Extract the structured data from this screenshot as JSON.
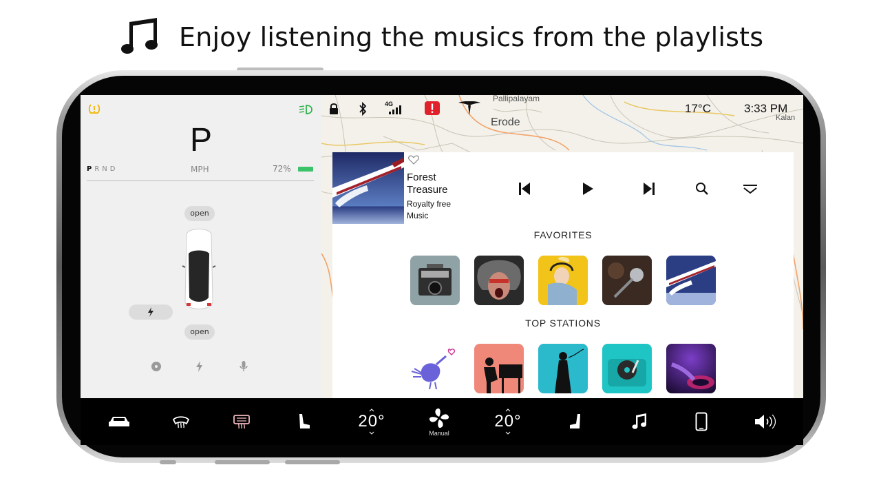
{
  "headline": {
    "icon": "music-note-icon",
    "text": "Enjoy listening the musics from the playlists"
  },
  "car_panel": {
    "gear": "P",
    "gears": [
      "P",
      "R",
      "N",
      "D"
    ],
    "active_gear": "P",
    "speed_unit": "MPH",
    "battery_percent": "72%",
    "battery_fraction": 0.72,
    "frunk_label": "open",
    "trunk_label": "open",
    "charge_icon": "bolt-icon",
    "bottom_icons": [
      "disc-icon",
      "bolt-icon",
      "microphone-icon"
    ],
    "status_icons": [
      "tire-warning-icon",
      "headlight-icon"
    ]
  },
  "status_bar": {
    "icons": [
      "lock-icon",
      "bluetooth-icon",
      "4g-signal-icon",
      "alert-icon",
      "tesla-logo-icon"
    ],
    "network": "4G",
    "temperature": "17°C",
    "time": "3:33 PM"
  },
  "map": {
    "labels": [
      "Pallipalayam",
      "Erode",
      "Kalan"
    ]
  },
  "now_playing": {
    "title": "Forest Treasure",
    "artist": "Royalty free Music",
    "controls": [
      "skip-back-icon",
      "play-icon",
      "skip-forward-icon",
      "search-icon",
      "collapse-icon"
    ]
  },
  "favorites": {
    "heading": "FAVORITES",
    "items": [
      {
        "icon": "boombox-art"
      },
      {
        "icon": "rocker-art"
      },
      {
        "icon": "headphone-girl-art"
      },
      {
        "icon": "microphone-art"
      },
      {
        "icon": "guitar-studio-art"
      }
    ]
  },
  "top_stations": {
    "heading": "TOP STATIONS",
    "items": [
      {
        "icon": "singing-bird-art"
      },
      {
        "icon": "pianist-art"
      },
      {
        "icon": "singer-art"
      },
      {
        "icon": "turntable-art"
      },
      {
        "icon": "dj-art"
      }
    ]
  },
  "bottom_bar": {
    "items": [
      "car-icon",
      "front-defrost-icon",
      "rear-defrost-icon",
      "seat-left-icon",
      "fan-icon",
      "seat-right-icon",
      "music-note-icon",
      "phone-icon",
      "volume-icon"
    ],
    "left_temp": "20°",
    "right_temp": "20°",
    "fan_mode": "Manual"
  },
  "colors": {
    "battery": "#3cc36a",
    "alert": "#e0202a",
    "warning": "#f0b400",
    "lights": "#2fb34a",
    "map_bg": "#f3f1ea"
  }
}
